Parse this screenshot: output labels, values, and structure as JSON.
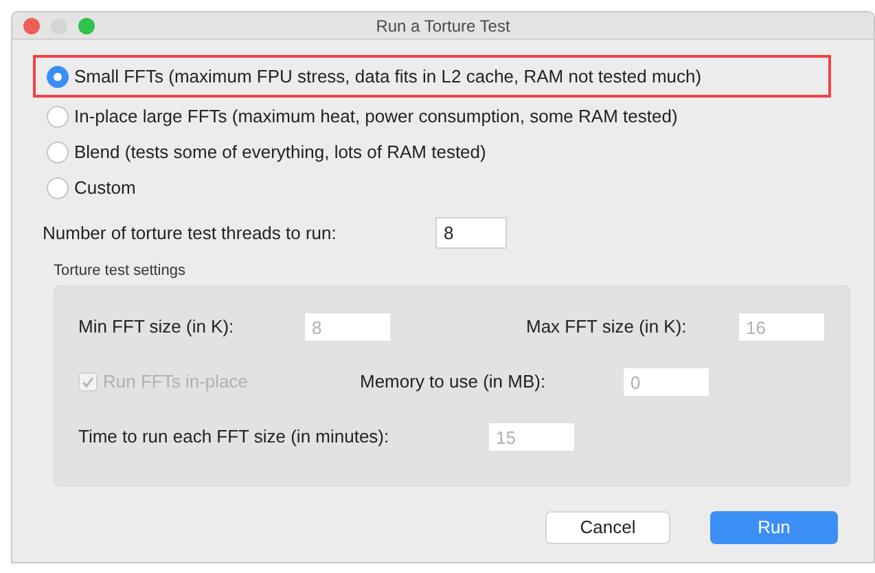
{
  "window": {
    "title": "Run a Torture Test"
  },
  "options": [
    {
      "label": "Small FFTs (maximum FPU stress, data fits in L2 cache, RAM not tested much)",
      "selected": true,
      "highlighted": true
    },
    {
      "label": "In-place large FFTs (maximum heat, power consumption, some RAM tested)",
      "selected": false,
      "highlighted": false
    },
    {
      "label": "Blend (tests some of everything, lots of RAM tested)",
      "selected": false,
      "highlighted": false
    },
    {
      "label": "Custom",
      "selected": false,
      "highlighted": false
    }
  ],
  "threads": {
    "label": "Number of torture test threads to run:",
    "value": "8"
  },
  "settings": {
    "title": "Torture test settings",
    "rows": [
      [
        {
          "kind": "field",
          "label": "Min FFT size (in K):",
          "value": "8",
          "disabled": true
        },
        {
          "kind": "field",
          "label": "Max FFT size (in K):",
          "value": "16",
          "disabled": true
        }
      ],
      [
        {
          "kind": "checkbox",
          "label": "Run FFTs in-place",
          "checked": true,
          "disabled": true
        },
        {
          "kind": "field",
          "label": "Memory to use (in MB):",
          "value": "0",
          "disabled": true
        }
      ],
      [
        {
          "kind": "field",
          "label": "Time to run each FFT size (in minutes):",
          "value": "15",
          "disabled": true
        }
      ]
    ]
  },
  "buttons": [
    {
      "label": "Cancel",
      "kind": "default"
    },
    {
      "label": "Run",
      "kind": "primary"
    }
  ]
}
